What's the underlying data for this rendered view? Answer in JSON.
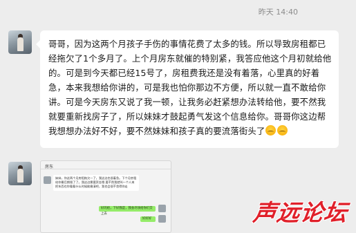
{
  "chat": {
    "timestamp": "昨天 14:40",
    "message": "哥哥，因为这两个月孩子手伤的事情花费了太多的钱。所以导致房租都已经拖欠了1个多月了。上个月房东就催的特别紧，我答应他这个月初就给他的。可是到今天都已经15号了，房租费我还是没有着落，心里真的好着急，本来我想给你讲的，可是我也怕你那边不方便，所以就一直不敢给你讲。可是今天房东又说了我一顿，让我务必赶紧想办法转给他，要不然我就要重新找房子了，所以妹妹才鼓起勇气发这个信息给你。哥哥你这边帮我想想办法好不好，要不然妹妹和孩子真的要流落街头了",
    "emoji_icon": "sad-face-emoji-icon"
  },
  "screenshot": {
    "title": "房东",
    "message": "妹妹，你这两个月房租拖欠一了，我这边也很着急。下个月房租给你最后期限了了。我这边需要资金哦 要不然我就叫一个人来把东西也你看看什么时候能缴清吧，我也会很不舍得你走",
    "reply_1": "好的给，下好我是，我会尽快给你们交上去",
    "reply_2": "好好好"
  },
  "watermark": {
    "text": "声远论坛",
    "color": "#e0202a"
  }
}
